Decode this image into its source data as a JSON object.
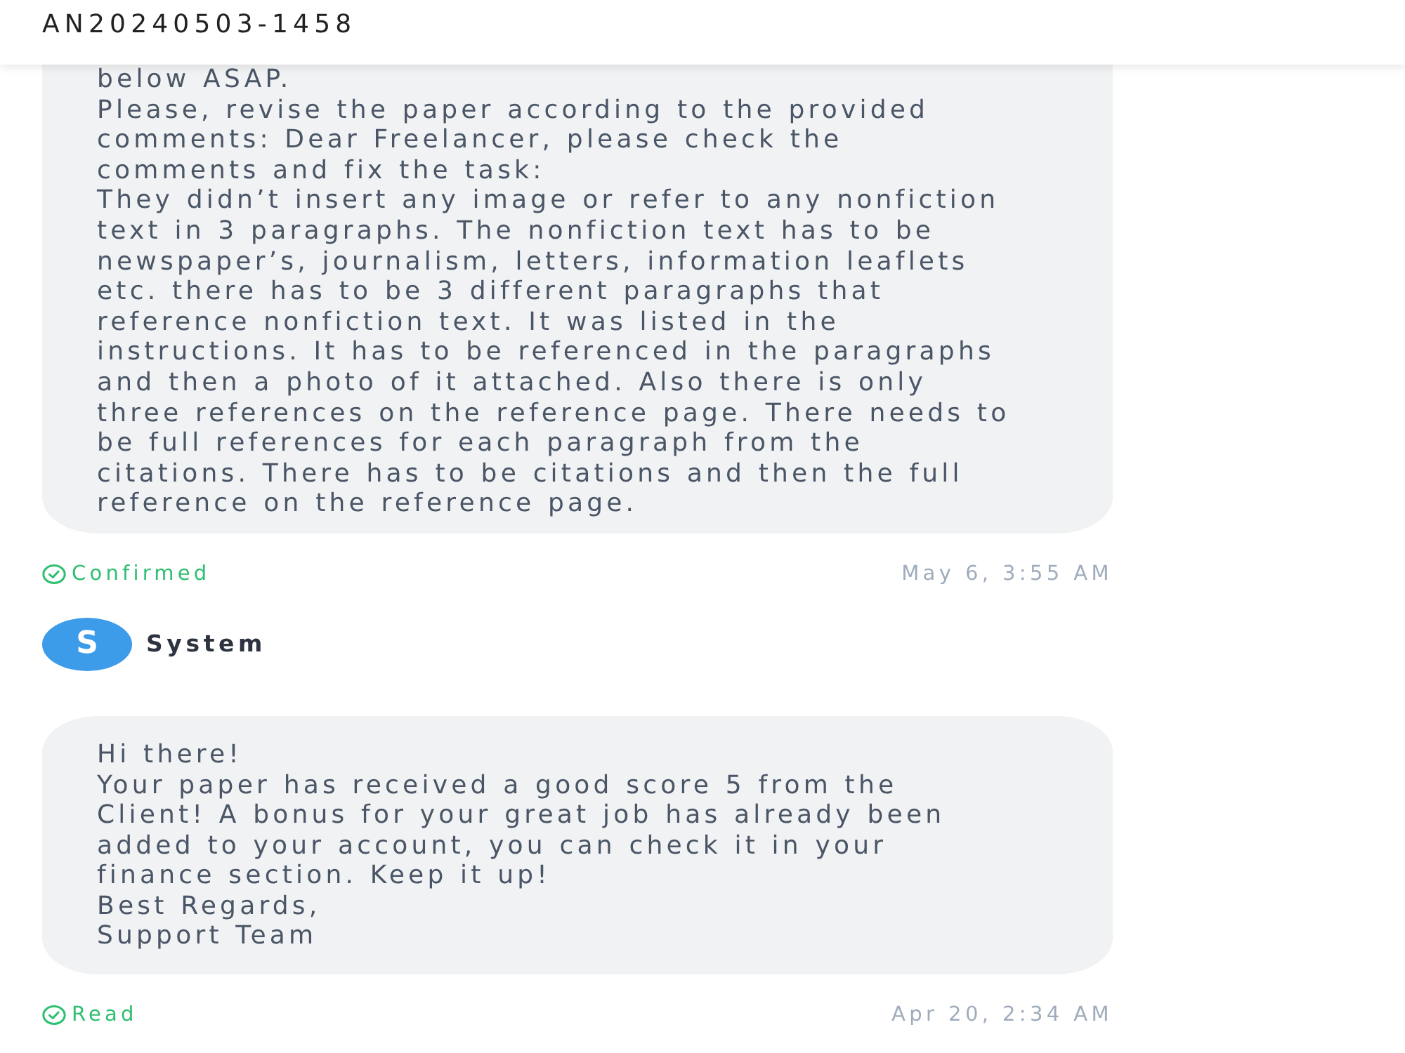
{
  "header": {
    "title": "AN20240503-1458"
  },
  "messages": [
    {
      "text": "below ASAP.\nPlease, revise the paper according to the provided comments: Dear Freelancer, please check the comments and fix the task:\nThey didn’t insert any image or refer to any nonfiction text in 3 paragraphs. The nonfiction text has to be newspaper’s, journalism, letters, information leaflets etc. there has to be 3 different paragraphs that reference nonfiction text. It was listed in the instructions. It has to be referenced in the paragraphs and then a photo of it attached. Also there is only three references on the reference page. There needs to be full references for each paragraph from the citations. There has to be citations and then the full reference on the reference page.",
      "status": "Confirmed",
      "time": "May 6, 3:55 AM"
    },
    {
      "sender": {
        "initial": "S",
        "name": "System"
      },
      "text": "Hi there!\nYour paper has received a good score 5 from the Client! A bonus for your great job has already been added to your account, you can check it in your finance section. Keep it up!\nBest Regards,\nSupport Team",
      "status": "Read",
      "time": "Apr 20, 2:34 AM"
    }
  ]
}
